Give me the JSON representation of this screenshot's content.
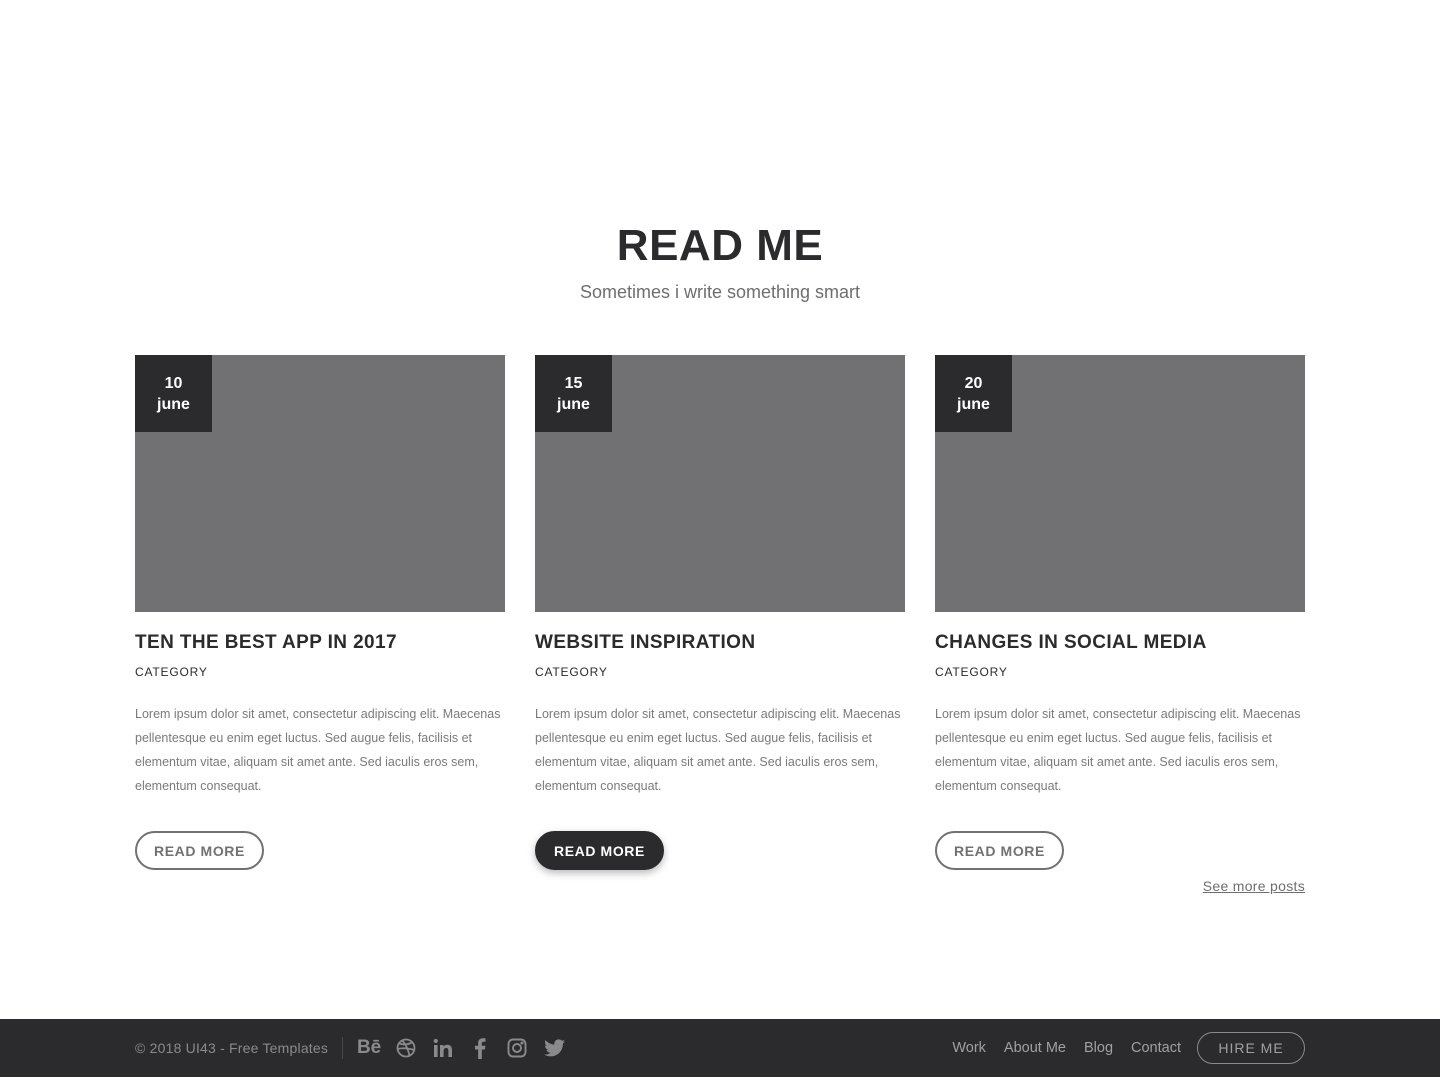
{
  "section": {
    "title": "READ ME",
    "subtitle": "Sometimes i write something smart"
  },
  "posts": [
    {
      "day": "10",
      "month": "june",
      "title": "TEN THE BEST APP IN 2017",
      "category": "CATEGORY",
      "excerpt": "Lorem ipsum dolor sit amet, consectetur adipiscing elit. Maecenas pellentesque eu enim eget luctus. Sed augue felis, facilisis et elementum vitae, aliquam sit amet ante. Sed iaculis eros sem, elementum consequat.",
      "button_label": "READ MORE"
    },
    {
      "day": "15",
      "month": "june",
      "title": "WEBSITE INSPIRATION",
      "category": "CATEGORY",
      "excerpt": "Lorem ipsum dolor sit amet, consectetur adipiscing elit. Maecenas pellentesque eu enim eget luctus. Sed augue felis, facilisis et elementum vitae, aliquam sit amet ante. Sed iaculis eros sem, elementum consequat.",
      "button_label": "READ MORE"
    },
    {
      "day": "20",
      "month": "june",
      "title": "CHANGES IN SOCIAL MEDIA",
      "category": "CATEGORY",
      "excerpt": "Lorem ipsum dolor sit amet, consectetur adipiscing elit. Maecenas pellentesque eu enim eget luctus. Sed augue felis, facilisis et elementum vitae, aliquam sit amet ante. Sed iaculis eros sem, elementum consequat.",
      "button_label": "READ MORE"
    }
  ],
  "see_more": "See more posts",
  "footer": {
    "copyright": "© 2018 UI43 - Free Templates",
    "socials": [
      {
        "icon": "behance-icon",
        "glyph": "Bē"
      },
      {
        "icon": "dribbble-icon"
      },
      {
        "icon": "linkedin-icon"
      },
      {
        "icon": "facebook-icon"
      },
      {
        "icon": "instagram-icon"
      },
      {
        "icon": "twitter-icon"
      }
    ],
    "nav": [
      "Work",
      "About Me",
      "Blog",
      "Contact"
    ],
    "hire_label": "HIRE ME"
  },
  "colors": {
    "dark": "#2b2b2d",
    "image_placeholder": "#717173",
    "muted_text": "#7a7a7c",
    "footer_text": "#8a8a8c"
  }
}
